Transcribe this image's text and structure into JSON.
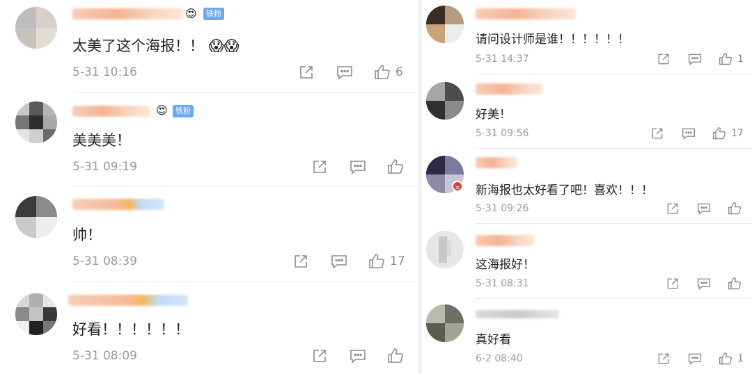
{
  "left_comments": [
    {
      "text": "太美了这个海报！！ 😱😱",
      "time": "5-31 10:16",
      "likes": "6",
      "tag": "铁粉"
    },
    {
      "text": "美美美！",
      "time": "5-31 09:19",
      "likes": "",
      "tag": "铁粉"
    },
    {
      "text": "帅！",
      "time": "5-31 08:39",
      "likes": "17"
    },
    {
      "text": "好看！！！！！！",
      "time": "5-31 08:09",
      "likes": ""
    }
  ],
  "right_comments": [
    {
      "text": "请问设计师是谁！！！！！！",
      "time": "5-31 14:37",
      "likes": "1"
    },
    {
      "text": "好美！",
      "time": "5-31 09:56",
      "likes": "17"
    },
    {
      "text": "新海报也太好看了吧！喜欢！！！",
      "time": "5-31 09:26",
      "likes": ""
    },
    {
      "text": "这海报好！",
      "time": "5-31 08:31",
      "likes": ""
    },
    {
      "text": "真好看",
      "time": "6-2 08:40",
      "likes": "1"
    }
  ],
  "icons": {
    "share": "share-icon",
    "comment": "comment-icon",
    "like": "thumbs-up-icon"
  },
  "colors": {
    "fan_tag": "#6fa8ec",
    "meta_text": "#9a9a9a",
    "badge_red": "#e2333a"
  }
}
